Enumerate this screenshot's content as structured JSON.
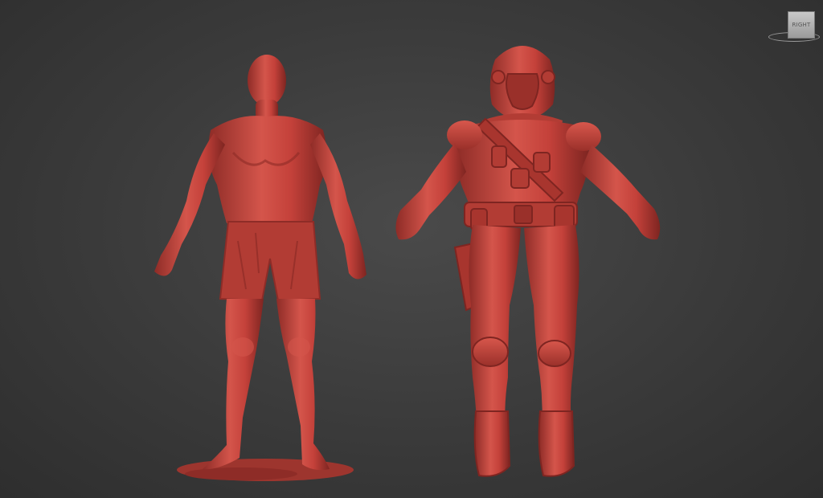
{
  "viewport": {
    "view_label": "RIGHT"
  },
  "colors": {
    "background": "#3a3a3a",
    "clay": "#c4413a",
    "clay_shadow": "#8e2c27",
    "clay_highlight": "#e06a5e"
  },
  "models": [
    {
      "name": "human-scan-figure"
    },
    {
      "name": "spacesuit-soldier-figure"
    }
  ]
}
